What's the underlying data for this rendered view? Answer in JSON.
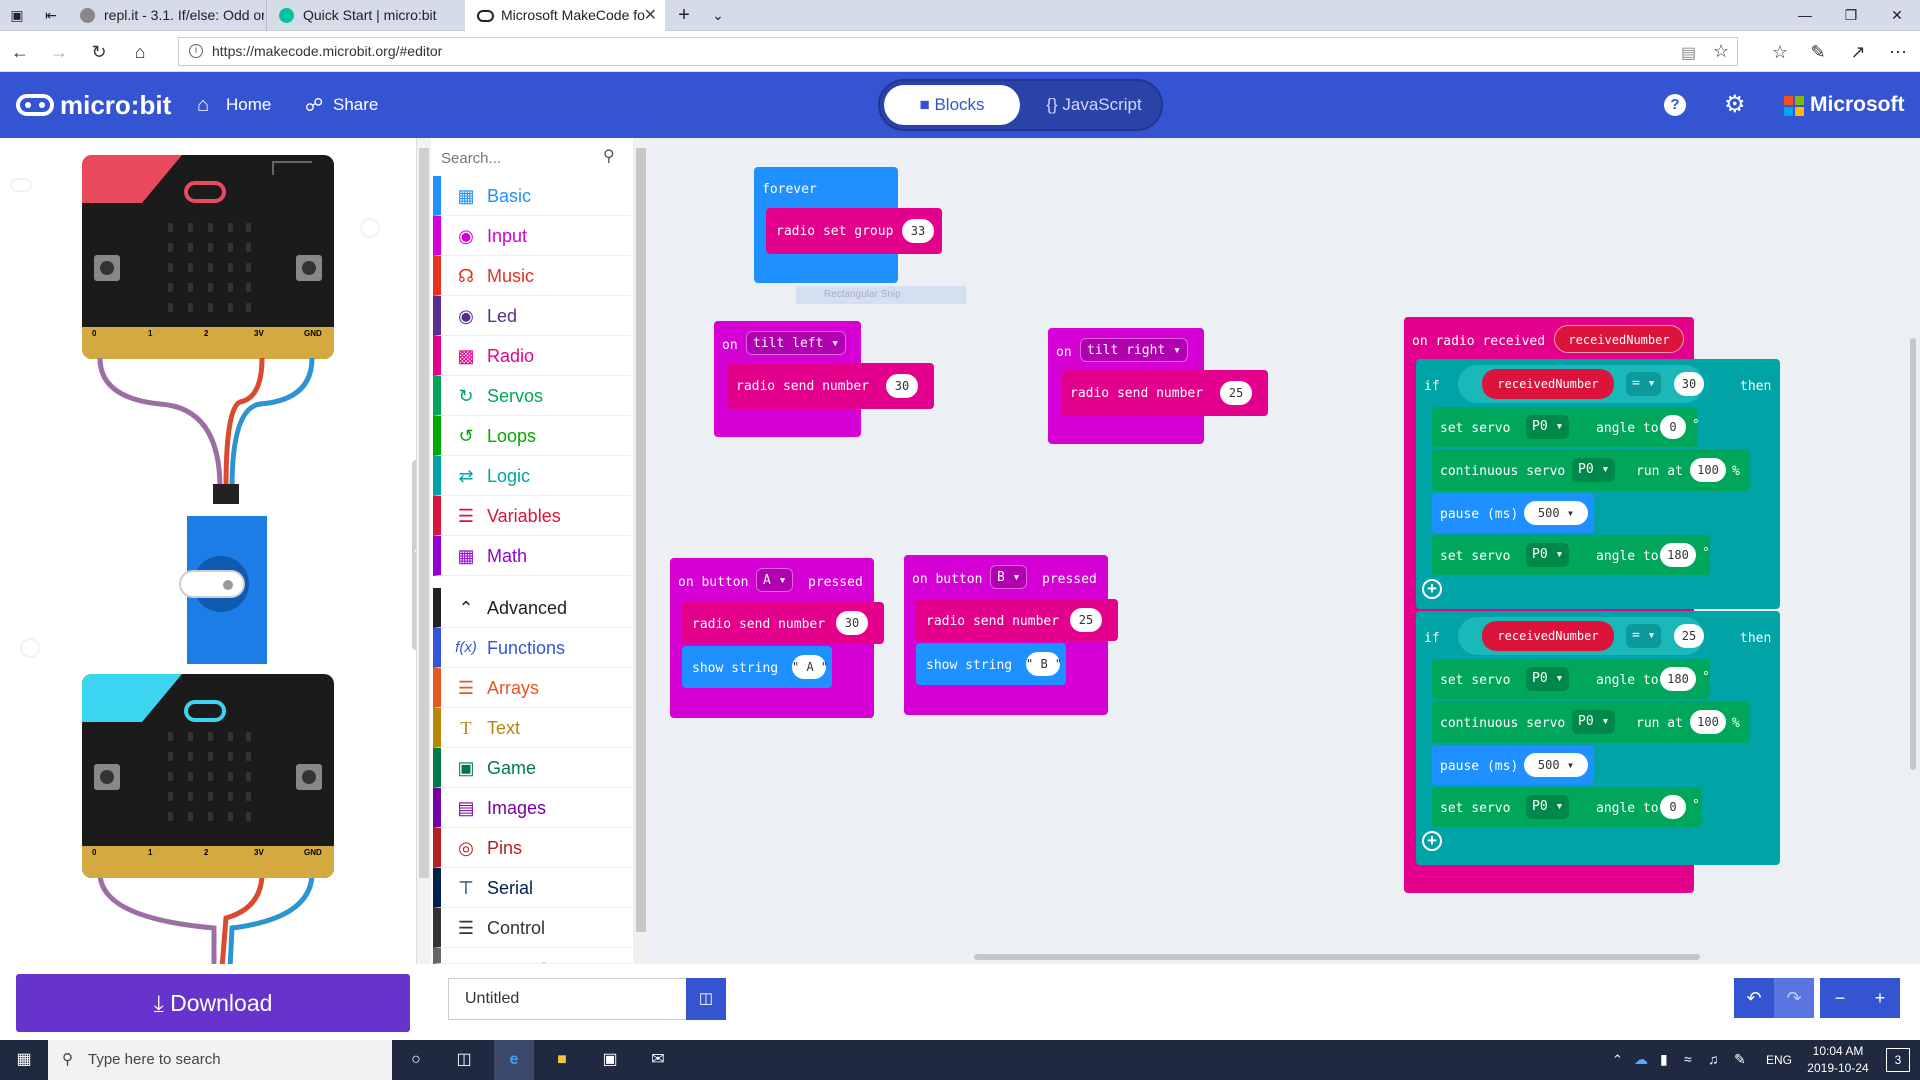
{
  "browser": {
    "tabs": [
      {
        "title": "repl.it - 3.1. If/else: Odd or e"
      },
      {
        "title": "Quick Start | micro:bit"
      },
      {
        "title": "Microsoft MakeCode fo"
      }
    ],
    "url": "https://makecode.microbit.org/#editor"
  },
  "header": {
    "logo": "micro:bit",
    "home_label": "Home",
    "share_label": "Share",
    "blocks_label": "Blocks",
    "js_label": "JavaScript",
    "brand": "Microsoft"
  },
  "simulator": {
    "pins": [
      "0",
      "1",
      "2",
      "3V",
      "GND"
    ]
  },
  "toolbox": {
    "search_placeholder": "Search...",
    "categories": [
      {
        "label": "Basic",
        "color": "#1e90ff"
      },
      {
        "label": "Input",
        "color": "#d400d4"
      },
      {
        "label": "Music",
        "color": "#e63022"
      },
      {
        "label": "Led",
        "color": "#5c2d91"
      },
      {
        "label": "Radio",
        "color": "#e3008c"
      },
      {
        "label": "Servos",
        "color": "#00a65a"
      },
      {
        "label": "Loops",
        "color": "#00aa00"
      },
      {
        "label": "Logic",
        "color": "#00a4a6"
      },
      {
        "label": "Variables",
        "color": "#dc143c"
      },
      {
        "label": "Math",
        "color": "#9400d3"
      },
      {
        "label": "Advanced",
        "color": "#222222"
      },
      {
        "label": "Functions",
        "color": "#3455db"
      },
      {
        "label": "Arrays",
        "color": "#e65722"
      },
      {
        "label": "Text",
        "color": "#b8860b"
      },
      {
        "label": "Game",
        "color": "#007a4b"
      },
      {
        "label": "Images",
        "color": "#7600a8"
      },
      {
        "label": "Pins",
        "color": "#b22222"
      },
      {
        "label": "Serial",
        "color": "#002050"
      },
      {
        "label": "Control",
        "color": "#333333"
      },
      {
        "label": "Extensions",
        "color": "#666666"
      }
    ]
  },
  "workspace": {
    "forever": {
      "label": "forever",
      "inner": "radio set group",
      "value": "33"
    },
    "tilt_left": {
      "on": "on",
      "gesture": "tilt left",
      "inner": "radio send number",
      "value": "30"
    },
    "tilt_right": {
      "on": "on",
      "gesture": "tilt right",
      "inner": "radio send number",
      "value": "25"
    },
    "snip_label": "Rectangular Snip",
    "button_a": {
      "on": "on button",
      "button": "A",
      "pressed": "pressed",
      "inner": "radio send number",
      "value": "30",
      "show": "show string",
      "str": "\" A \""
    },
    "button_b": {
      "on": "on button",
      "button": "B",
      "pressed": "pressed",
      "inner": "radio send number",
      "value": "25",
      "show": "show string",
      "str": "\" B \""
    },
    "received": {
      "label": "on radio received",
      "var": "receivedNumber",
      "if_label": "if",
      "then_label": "then",
      "op": "=",
      "if1_value": "30",
      "if2_value": "25",
      "set_servo": "set servo",
      "pin": "P0",
      "angle_to": "angle to",
      "degree": "°",
      "continuous": "continuous servo",
      "run_at": "run at",
      "pct": "%",
      "pause": "pause (ms)",
      "pause_value": "500",
      "speed_value": "100",
      "a0": "0",
      "a180": "180"
    }
  },
  "bottom": {
    "download": "Download",
    "project_name": "Untitled"
  },
  "taskbar": {
    "search": "Type here to search",
    "lang": "ENG",
    "time": "10:04 AM",
    "date": "2019-10-24",
    "notif": "3"
  }
}
